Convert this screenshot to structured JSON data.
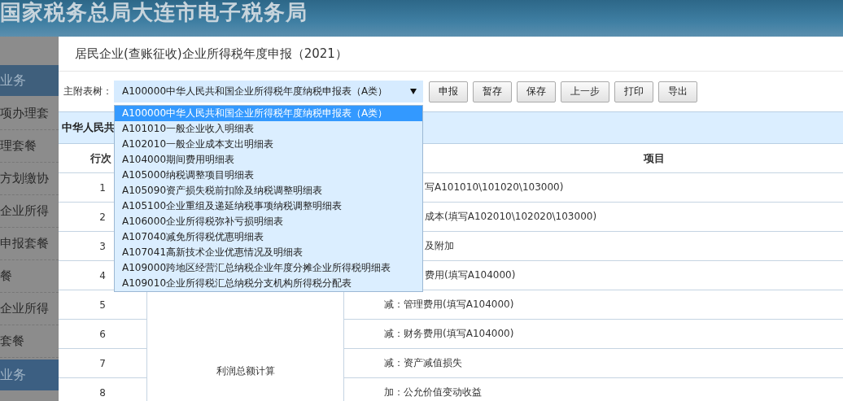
{
  "site": {
    "title": "国家税务总局大连市电子税务局"
  },
  "sidebar": {
    "items": [
      {
        "label": "业务",
        "kind": "header"
      },
      {
        "label": "项办理套",
        "kind": "link"
      },
      {
        "label": "理套餐",
        "kind": "link"
      },
      {
        "label": "方划缴协",
        "kind": "link"
      },
      {
        "label": "企业所得",
        "kind": "link"
      },
      {
        "label": "申报套餐",
        "kind": "link"
      },
      {
        "label": "餐",
        "kind": "link"
      },
      {
        "label": "企业所得",
        "kind": "link"
      },
      {
        "label": "套餐",
        "kind": "link"
      },
      {
        "label": "业务",
        "kind": "header"
      }
    ]
  },
  "dialog": {
    "title": "居民企业(查账征收)企业所得税年度申报（2021）",
    "toolbar": {
      "label": "主附表树：",
      "select": {
        "value": "A100000中华人民共和国企业所得税年度纳税申报表（A类）",
        "expanded": true,
        "options": [
          {
            "label": "A100000中华人民共和国企业所得税年度纳税申报表（A类）",
            "selected": true
          },
          {
            "label": "A101010一般企业收入明细表",
            "selected": false
          },
          {
            "label": "A102010一般企业成本支出明细表",
            "selected": false
          },
          {
            "label": "A104000期间费用明细表",
            "selected": false
          },
          {
            "label": "A105000纳税调整项目明细表",
            "selected": false
          },
          {
            "label": "A105090资产损失税前扣除及纳税调整明细表",
            "selected": false
          },
          {
            "label": "A105100企业重组及递延纳税事项纳税调整明细表",
            "selected": false
          },
          {
            "label": "A106000企业所得税弥补亏损明细表",
            "selected": false
          },
          {
            "label": "A107040减免所得税优惠明细表",
            "selected": false
          },
          {
            "label": "A107041高新技术企业优惠情况及明细表",
            "selected": false
          },
          {
            "label": "A109000跨地区经营汇总纳税企业年度分摊企业所得税明细表",
            "selected": false
          },
          {
            "label": "A109010企业所得税汇总纳税分支机构所得税分配表",
            "selected": false
          }
        ]
      },
      "buttons": [
        "申报",
        "暂存",
        "保存",
        "上一步",
        "打印",
        "导出"
      ]
    },
    "table": {
      "section_title": "中华人民共",
      "columns": [
        "行次",
        "项目"
      ],
      "category": "利润总额计算",
      "rows": [
        {
          "number": "1",
          "item": "写A101010\\101020\\103000)",
          "kind": "covered"
        },
        {
          "number": "2",
          "item": "成本(填写A102010\\102020\\103000)",
          "kind": "covered"
        },
        {
          "number": "3",
          "item": "及附加",
          "kind": "covered"
        },
        {
          "number": "4",
          "item": "费用(填写A104000)",
          "kind": "covered"
        },
        {
          "number": "5",
          "item": "减：管理费用(填写A104000)",
          "kind": "full"
        },
        {
          "number": "6",
          "item": "减：财务费用(填写A104000)",
          "kind": "full"
        },
        {
          "number": "7",
          "item": "减：资产减值损失",
          "kind": "full"
        },
        {
          "number": "8",
          "item": "加：公允价值变动收益",
          "kind": "full"
        }
      ]
    }
  }
}
